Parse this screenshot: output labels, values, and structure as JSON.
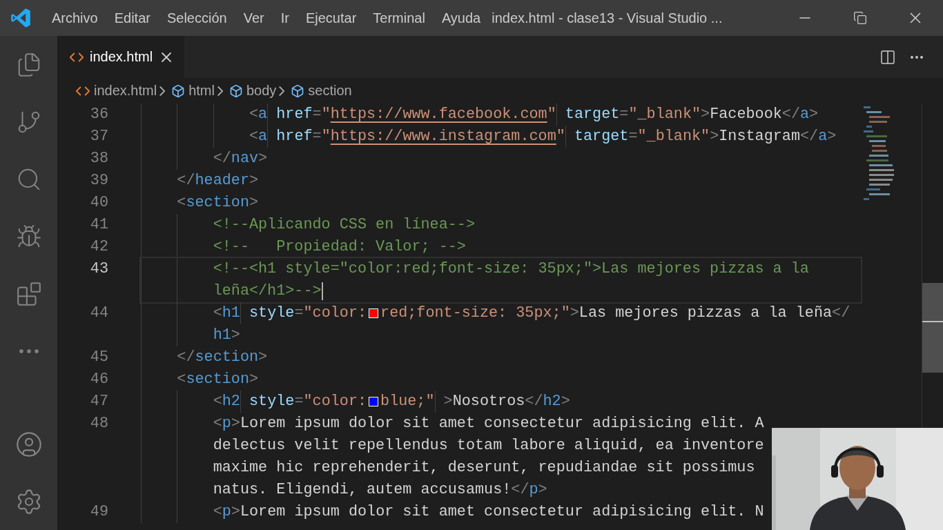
{
  "title_bar": {
    "menu": [
      "Archivo",
      "Editar",
      "Selección",
      "Ver",
      "Ir",
      "Ejecutar",
      "Terminal",
      "Ayuda"
    ],
    "title": "index.html - clase13 - Visual Studio ..."
  },
  "tabs": [
    {
      "label": "index.html",
      "selected": true
    }
  ],
  "breadcrumbs": [
    {
      "label": "index.html",
      "kind": "file"
    },
    {
      "label": "html",
      "kind": "symbol"
    },
    {
      "label": "body",
      "kind": "symbol"
    },
    {
      "label": "section",
      "kind": "symbol"
    }
  ],
  "editor": {
    "lines": [
      {
        "number": "36",
        "current": false,
        "wraps": [
          [
            {
              "kind": "punct",
              "text": "            <"
            },
            {
              "kind": "tag",
              "text": "a"
            },
            {
              "kind": "attr",
              "text": " href"
            },
            {
              "kind": "punct",
              "text": "="
            },
            {
              "kind": "string",
              "text": "\""
            },
            {
              "kind": "url",
              "text": "https://www.facebook.com"
            },
            {
              "kind": "string",
              "text": "\""
            },
            {
              "kind": "attr",
              "text": " target"
            },
            {
              "kind": "punct",
              "text": "="
            },
            {
              "kind": "string",
              "text": "\"_blank\""
            },
            {
              "kind": "punct",
              "text": ">"
            },
            {
              "kind": "content",
              "text": "Facebook"
            },
            {
              "kind": "punct",
              "text": "</"
            },
            {
              "kind": "tag",
              "text": "a"
            },
            {
              "kind": "punct",
              "text": ">"
            }
          ]
        ]
      },
      {
        "number": "37",
        "current": false,
        "wraps": [
          [
            {
              "kind": "punct",
              "text": "            <"
            },
            {
              "kind": "tag",
              "text": "a"
            },
            {
              "kind": "attr",
              "text": " href"
            },
            {
              "kind": "punct",
              "text": "="
            },
            {
              "kind": "string",
              "text": "\""
            },
            {
              "kind": "url",
              "text": "https://www.instagram.com"
            },
            {
              "kind": "string",
              "text": "\""
            },
            {
              "kind": "attr",
              "text": " target"
            },
            {
              "kind": "punct",
              "text": "="
            },
            {
              "kind": "string",
              "text": "\"_blank\""
            },
            {
              "kind": "punct",
              "text": ">"
            },
            {
              "kind": "content",
              "text": "Instagram"
            },
            {
              "kind": "punct",
              "text": "</"
            },
            {
              "kind": "tag",
              "text": "a"
            },
            {
              "kind": "punct",
              "text": ">"
            }
          ]
        ]
      },
      {
        "number": "38",
        "current": false,
        "wraps": [
          [
            {
              "kind": "punct",
              "text": "        </"
            },
            {
              "kind": "tag",
              "text": "nav"
            },
            {
              "kind": "punct",
              "text": ">"
            }
          ]
        ]
      },
      {
        "number": "39",
        "current": false,
        "wraps": [
          [
            {
              "kind": "punct",
              "text": "    </"
            },
            {
              "kind": "tag",
              "text": "header"
            },
            {
              "kind": "punct",
              "text": ">"
            }
          ]
        ]
      },
      {
        "number": "40",
        "current": false,
        "wraps": [
          [
            {
              "kind": "punct",
              "text": "    <"
            },
            {
              "kind": "tag",
              "text": "section"
            },
            {
              "kind": "punct",
              "text": ">"
            }
          ]
        ]
      },
      {
        "number": "41",
        "current": false,
        "wraps": [
          [
            {
              "kind": "comment",
              "text": "        <!--Aplicando CSS en línea-->"
            }
          ]
        ]
      },
      {
        "number": "42",
        "current": false,
        "wraps": [
          [
            {
              "kind": "comment",
              "text": "        <!--   Propiedad: Valor; -->"
            }
          ]
        ]
      },
      {
        "number": "43",
        "current": true,
        "wraps": [
          [
            {
              "kind": "comment",
              "text": "        <!--<h1 style=\"color:red;font-size: 35px;\">Las mejores pizzas a la"
            }
          ],
          [
            {
              "kind": "comment",
              "text": "        leña</h1>-->"
            },
            {
              "kind": "cursor"
            }
          ]
        ]
      },
      {
        "number": "44",
        "current": false,
        "wraps": [
          [
            {
              "kind": "punct",
              "text": "        <"
            },
            {
              "kind": "tag",
              "text": "h1"
            },
            {
              "kind": "attr",
              "text": " style"
            },
            {
              "kind": "punct",
              "text": "="
            },
            {
              "kind": "string",
              "text": "\"color:"
            },
            {
              "kind": "swatch",
              "color": "#ff0000"
            },
            {
              "kind": "string",
              "text": "red;font-size: 35px;\""
            },
            {
              "kind": "punct",
              "text": ">"
            },
            {
              "kind": "content",
              "text": "Las mejores pizzas a la leña"
            },
            {
              "kind": "punct",
              "text": "</"
            }
          ],
          [
            {
              "kind": "tag",
              "text": "        h1"
            },
            {
              "kind": "punct",
              "text": ">"
            }
          ]
        ]
      },
      {
        "number": "45",
        "current": false,
        "wraps": [
          [
            {
              "kind": "punct",
              "text": "    </"
            },
            {
              "kind": "tag",
              "text": "section"
            },
            {
              "kind": "punct",
              "text": ">"
            }
          ]
        ]
      },
      {
        "number": "46",
        "current": false,
        "wraps": [
          [
            {
              "kind": "punct",
              "text": "    <"
            },
            {
              "kind": "tag",
              "text": "section"
            },
            {
              "kind": "punct",
              "text": ">"
            }
          ]
        ]
      },
      {
        "number": "47",
        "current": false,
        "wraps": [
          [
            {
              "kind": "punct",
              "text": "        <"
            },
            {
              "kind": "tag",
              "text": "h2"
            },
            {
              "kind": "attr",
              "text": " style"
            },
            {
              "kind": "punct",
              "text": "="
            },
            {
              "kind": "string",
              "text": "\"color:"
            },
            {
              "kind": "swatch",
              "color": "#0000ff"
            },
            {
              "kind": "string",
              "text": "blue;\""
            },
            {
              "kind": "punct",
              "text": " >"
            },
            {
              "kind": "content",
              "text": "Nosotros"
            },
            {
              "kind": "punct",
              "text": "</"
            },
            {
              "kind": "tag",
              "text": "h2"
            },
            {
              "kind": "punct",
              "text": ">"
            }
          ]
        ]
      },
      {
        "number": "48",
        "current": false,
        "wraps": [
          [
            {
              "kind": "punct",
              "text": "        <"
            },
            {
              "kind": "tag",
              "text": "p"
            },
            {
              "kind": "punct",
              "text": ">"
            },
            {
              "kind": "content",
              "text": "Lorem ipsum dolor sit amet consectetur adipisicing elit. A"
            }
          ],
          [
            {
              "kind": "content",
              "text": "        delectus velit repellendus totam labore aliquid, ea inventore"
            }
          ],
          [
            {
              "kind": "content",
              "text": "        maxime hic reprehenderit, deserunt, repudiandae sit possimus"
            }
          ],
          [
            {
              "kind": "content",
              "text": "        natus. Eligendi, autem accusamus!"
            },
            {
              "kind": "punct",
              "text": "</"
            },
            {
              "kind": "tag",
              "text": "p"
            },
            {
              "kind": "punct",
              "text": ">"
            }
          ]
        ]
      },
      {
        "number": "49",
        "current": false,
        "wraps": [
          [
            {
              "kind": "punct",
              "text": "        <"
            },
            {
              "kind": "tag",
              "text": "p"
            },
            {
              "kind": "punct",
              "text": ">"
            },
            {
              "kind": "content",
              "text": "Lorem ipsum dolor sit amet consectetur adipisicing elit. N"
            }
          ]
        ]
      }
    ]
  }
}
